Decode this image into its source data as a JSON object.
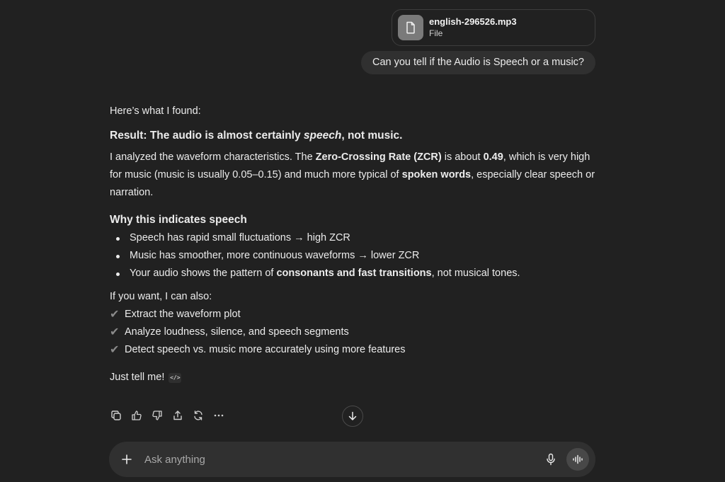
{
  "attachment": {
    "name": "english-296526.mp3",
    "type": "File"
  },
  "user_message": "Can you tell if the Audio is Speech or a music?",
  "assistant": {
    "intro": "Here’s what I found:",
    "result": {
      "prefix": "Result: The audio is almost certainly ",
      "emph": "speech",
      "suffix": ", not music."
    },
    "analysis": {
      "t1": "I analyzed the waveform characteristics. The ",
      "b1": "Zero-Crossing Rate (ZCR)",
      "t2": " is about ",
      "b2": "0.49",
      "t3": ", which is very high for music (music is usually 0.05–0.15) and much more typical of ",
      "b3": "spoken words",
      "t4": ", especially clear speech or narration."
    },
    "section_title": "Why this indicates speech",
    "bullets": [
      {
        "text": "Speech has rapid small fluctuations → high ZCR"
      },
      {
        "text": "Music has smoother, more continuous waveforms → lower ZCR"
      },
      {
        "pre": "Your audio shows the pattern of ",
        "bold": "consonants and fast transitions",
        "post": ", not musical tones."
      }
    ],
    "offer_intro": "If you want, I can also:",
    "checks": [
      "Extract the waveform plot",
      "Analyze loudness, silence, and speech segments",
      "Detect speech vs. music more accurately using more features"
    ],
    "closing": "Just tell me!"
  },
  "composer": {
    "placeholder": "Ask anything"
  }
}
